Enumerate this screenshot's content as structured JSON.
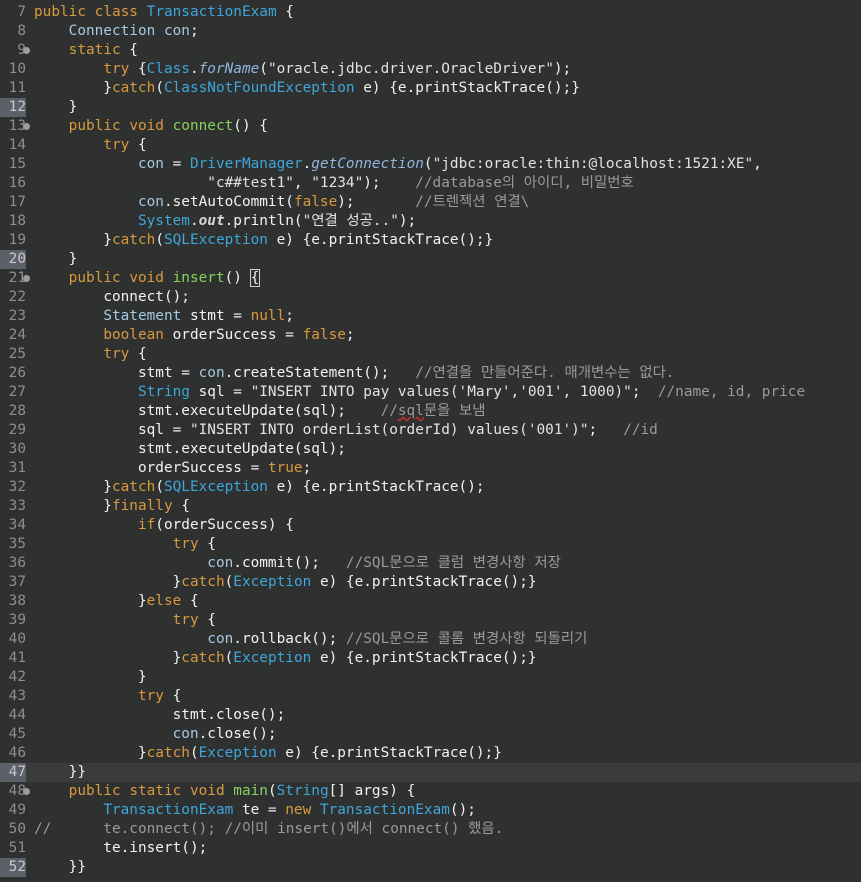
{
  "editor": {
    "language": "java",
    "current_line": 47,
    "colors": {
      "background": "#2f3030",
      "keyword": "#d99a3e",
      "class": "#3ea6d9",
      "method": "#89d05e",
      "comment": "#9a9a9a"
    },
    "lines": [
      {
        "no": "7",
        "fold": false,
        "hl": false,
        "tokens": [
          [
            "kw",
            "public"
          ],
          [
            "plain",
            " "
          ],
          [
            "kw",
            "class"
          ],
          [
            "plain",
            " "
          ],
          [
            "cls",
            "TransactionExam"
          ],
          [
            "plain",
            " {"
          ]
        ]
      },
      {
        "no": "8",
        "fold": false,
        "hl": false,
        "tokens": [
          [
            "plain",
            "    "
          ],
          [
            "type",
            "Connection"
          ],
          [
            "plain",
            " "
          ],
          [
            "field",
            "con"
          ],
          [
            "plain",
            ";"
          ]
        ]
      },
      {
        "no": "9",
        "fold": true,
        "hl": false,
        "tokens": [
          [
            "plain",
            "    "
          ],
          [
            "kw",
            "static"
          ],
          [
            "plain",
            " {"
          ]
        ]
      },
      {
        "no": "10",
        "fold": false,
        "hl": false,
        "tokens": [
          [
            "plain",
            "        "
          ],
          [
            "kw",
            "try"
          ],
          [
            "plain",
            " {"
          ],
          [
            "cls",
            "Class"
          ],
          [
            "plain",
            "."
          ],
          [
            "smeth",
            "forName"
          ],
          [
            "plain",
            "("
          ],
          [
            "str",
            "\"oracle.jdbc.driver.OracleDriver\""
          ],
          [
            "plain",
            ");"
          ]
        ]
      },
      {
        "no": "11",
        "fold": false,
        "hl": false,
        "tokens": [
          [
            "plain",
            "        }"
          ],
          [
            "kw",
            "catch"
          ],
          [
            "plain",
            "("
          ],
          [
            "cls",
            "ClassNotFoundException"
          ],
          [
            "plain",
            " e) {e.printStackTrace();}"
          ]
        ]
      },
      {
        "no": "12",
        "fold": false,
        "hl": true,
        "tokens": [
          [
            "plain",
            "    }"
          ]
        ]
      },
      {
        "no": "13",
        "fold": true,
        "hl": false,
        "tokens": [
          [
            "plain",
            "    "
          ],
          [
            "kw",
            "public"
          ],
          [
            "plain",
            " "
          ],
          [
            "kw",
            "void"
          ],
          [
            "plain",
            " "
          ],
          [
            "method",
            "connect"
          ],
          [
            "plain",
            "() {"
          ]
        ]
      },
      {
        "no": "14",
        "fold": false,
        "hl": false,
        "tokens": [
          [
            "plain",
            "        "
          ],
          [
            "kw",
            "try"
          ],
          [
            "plain",
            " {"
          ]
        ]
      },
      {
        "no": "15",
        "fold": false,
        "hl": false,
        "tokens": [
          [
            "plain",
            "            "
          ],
          [
            "field",
            "con"
          ],
          [
            "plain",
            " = "
          ],
          [
            "cls",
            "DriverManager"
          ],
          [
            "plain",
            "."
          ],
          [
            "smeth",
            "getConnection"
          ],
          [
            "plain",
            "("
          ],
          [
            "str",
            "\"jdbc:oracle:thin:@localhost:1521:XE\""
          ],
          [
            "plain",
            ","
          ]
        ]
      },
      {
        "no": "16",
        "fold": false,
        "hl": false,
        "tokens": [
          [
            "plain",
            "                    "
          ],
          [
            "str",
            "\"c##test1\""
          ],
          [
            "plain",
            ", "
          ],
          [
            "str",
            "\"1234\""
          ],
          [
            "plain",
            ");    "
          ],
          [
            "comment",
            "//database의 아이디, 비밀번호"
          ]
        ]
      },
      {
        "no": "17",
        "fold": false,
        "hl": false,
        "tokens": [
          [
            "plain",
            "            "
          ],
          [
            "field",
            "con"
          ],
          [
            "plain",
            ".setAutoCommit("
          ],
          [
            "kw",
            "false"
          ],
          [
            "plain",
            ");       "
          ],
          [
            "comment",
            "//트렌젝션 연결\\"
          ]
        ]
      },
      {
        "no": "18",
        "fold": false,
        "hl": false,
        "tokens": [
          [
            "plain",
            "            "
          ],
          [
            "cls",
            "System"
          ],
          [
            "plain",
            "."
          ],
          [
            "sfield",
            "out"
          ],
          [
            "plain",
            ".println("
          ],
          [
            "str",
            "\"연결 성공..\""
          ],
          [
            "plain",
            ");"
          ]
        ]
      },
      {
        "no": "19",
        "fold": false,
        "hl": false,
        "tokens": [
          [
            "plain",
            "        }"
          ],
          [
            "kw",
            "catch"
          ],
          [
            "plain",
            "("
          ],
          [
            "cls",
            "SQLException"
          ],
          [
            "plain",
            " e) {e.printStackTrace();}"
          ]
        ]
      },
      {
        "no": "20",
        "fold": false,
        "hl": true,
        "tokens": [
          [
            "plain",
            "    }"
          ]
        ]
      },
      {
        "no": "21",
        "fold": true,
        "hl": false,
        "tokens": [
          [
            "plain",
            "    "
          ],
          [
            "kw",
            "public"
          ],
          [
            "plain",
            " "
          ],
          [
            "kw",
            "void"
          ],
          [
            "plain",
            " "
          ],
          [
            "method",
            "insert"
          ],
          [
            "plain",
            "() "
          ],
          [
            "caret",
            "{"
          ]
        ]
      },
      {
        "no": "22",
        "fold": false,
        "hl": false,
        "tokens": [
          [
            "plain",
            "        "
          ],
          [
            "var",
            "connect"
          ],
          [
            "plain",
            "();"
          ]
        ]
      },
      {
        "no": "23",
        "fold": false,
        "hl": false,
        "tokens": [
          [
            "plain",
            "        "
          ],
          [
            "type",
            "Statement"
          ],
          [
            "plain",
            " stmt = "
          ],
          [
            "kw",
            "null"
          ],
          [
            "plain",
            ";"
          ]
        ]
      },
      {
        "no": "24",
        "fold": false,
        "hl": false,
        "tokens": [
          [
            "plain",
            "        "
          ],
          [
            "kw",
            "boolean"
          ],
          [
            "plain",
            " orderSuccess = "
          ],
          [
            "kw",
            "false"
          ],
          [
            "plain",
            ";"
          ]
        ]
      },
      {
        "no": "25",
        "fold": false,
        "hl": false,
        "tokens": [
          [
            "plain",
            "        "
          ],
          [
            "kw",
            "try"
          ],
          [
            "plain",
            " {"
          ]
        ]
      },
      {
        "no": "26",
        "fold": false,
        "hl": false,
        "tokens": [
          [
            "plain",
            "            stmt = "
          ],
          [
            "field",
            "con"
          ],
          [
            "plain",
            ".createStatement();   "
          ],
          [
            "comment",
            "//연결을 만들어준다. 매개변수는 없다."
          ]
        ]
      },
      {
        "no": "27",
        "fold": false,
        "hl": false,
        "tokens": [
          [
            "plain",
            "            "
          ],
          [
            "cls",
            "String"
          ],
          [
            "plain",
            " sql = "
          ],
          [
            "str",
            "\"INSERT INTO pay values('Mary','001', 1000)\""
          ],
          [
            "plain",
            ";  "
          ],
          [
            "comment",
            "//name, id, price"
          ]
        ]
      },
      {
        "no": "28",
        "fold": false,
        "hl": false,
        "tokens": [
          [
            "plain",
            "            stmt.executeUpdate(sql);    "
          ],
          [
            "comment",
            "//"
          ],
          [
            "squig",
            "sql"
          ],
          [
            "comment",
            "문을 보냄"
          ]
        ]
      },
      {
        "no": "29",
        "fold": false,
        "hl": false,
        "tokens": [
          [
            "plain",
            "            sql = "
          ],
          [
            "str",
            "\"INSERT INTO orderList(orderId) values('001')\""
          ],
          [
            "plain",
            ";   "
          ],
          [
            "comment",
            "//id"
          ]
        ]
      },
      {
        "no": "30",
        "fold": false,
        "hl": false,
        "tokens": [
          [
            "plain",
            "            stmt.executeUpdate(sql);"
          ]
        ]
      },
      {
        "no": "31",
        "fold": false,
        "hl": false,
        "tokens": [
          [
            "plain",
            "            orderSuccess = "
          ],
          [
            "kw",
            "true"
          ],
          [
            "plain",
            ";"
          ]
        ]
      },
      {
        "no": "32",
        "fold": false,
        "hl": false,
        "tokens": [
          [
            "plain",
            "        }"
          ],
          [
            "kw",
            "catch"
          ],
          [
            "plain",
            "("
          ],
          [
            "cls",
            "SQLException"
          ],
          [
            "plain",
            " e) {e.printStackTrace();"
          ]
        ]
      },
      {
        "no": "33",
        "fold": false,
        "hl": false,
        "tokens": [
          [
            "plain",
            "        }"
          ],
          [
            "kw",
            "finally"
          ],
          [
            "plain",
            " {"
          ]
        ]
      },
      {
        "no": "34",
        "fold": false,
        "hl": false,
        "tokens": [
          [
            "plain",
            "            "
          ],
          [
            "kw",
            "if"
          ],
          [
            "plain",
            "(orderSuccess) {"
          ]
        ]
      },
      {
        "no": "35",
        "fold": false,
        "hl": false,
        "tokens": [
          [
            "plain",
            "                "
          ],
          [
            "kw",
            "try"
          ],
          [
            "plain",
            " {"
          ]
        ]
      },
      {
        "no": "36",
        "fold": false,
        "hl": false,
        "tokens": [
          [
            "plain",
            "                    "
          ],
          [
            "field",
            "con"
          ],
          [
            "plain",
            ".commit();   "
          ],
          [
            "comment",
            "//SQL문으로 클럼 변경사항 저장"
          ]
        ]
      },
      {
        "no": "37",
        "fold": false,
        "hl": false,
        "tokens": [
          [
            "plain",
            "                }"
          ],
          [
            "kw",
            "catch"
          ],
          [
            "plain",
            "("
          ],
          [
            "cls",
            "Exception"
          ],
          [
            "plain",
            " e) {e.printStackTrace();}"
          ]
        ]
      },
      {
        "no": "38",
        "fold": false,
        "hl": false,
        "tokens": [
          [
            "plain",
            "            }"
          ],
          [
            "kw",
            "else"
          ],
          [
            "plain",
            " {"
          ]
        ]
      },
      {
        "no": "39",
        "fold": false,
        "hl": false,
        "tokens": [
          [
            "plain",
            "                "
          ],
          [
            "kw",
            "try"
          ],
          [
            "plain",
            " {"
          ]
        ]
      },
      {
        "no": "40",
        "fold": false,
        "hl": false,
        "tokens": [
          [
            "plain",
            "                    "
          ],
          [
            "field",
            "con"
          ],
          [
            "plain",
            ".rollback(); "
          ],
          [
            "comment",
            "//SQL문으로 콜롬 변경사항 되돌리기"
          ]
        ]
      },
      {
        "no": "41",
        "fold": false,
        "hl": false,
        "tokens": [
          [
            "plain",
            "                }"
          ],
          [
            "kw",
            "catch"
          ],
          [
            "plain",
            "("
          ],
          [
            "cls",
            "Exception"
          ],
          [
            "plain",
            " e) {e.printStackTrace();}"
          ]
        ]
      },
      {
        "no": "42",
        "fold": false,
        "hl": false,
        "tokens": [
          [
            "plain",
            "            }"
          ]
        ]
      },
      {
        "no": "43",
        "fold": false,
        "hl": false,
        "tokens": [
          [
            "plain",
            "            "
          ],
          [
            "kw",
            "try"
          ],
          [
            "plain",
            " {"
          ]
        ]
      },
      {
        "no": "44",
        "fold": false,
        "hl": false,
        "tokens": [
          [
            "plain",
            "                stmt.close();"
          ]
        ]
      },
      {
        "no": "45",
        "fold": false,
        "hl": false,
        "tokens": [
          [
            "plain",
            "                "
          ],
          [
            "field",
            "con"
          ],
          [
            "plain",
            ".close();"
          ]
        ]
      },
      {
        "no": "46",
        "fold": false,
        "hl": false,
        "tokens": [
          [
            "plain",
            "            }"
          ],
          [
            "kw",
            "catch"
          ],
          [
            "plain",
            "("
          ],
          [
            "cls",
            "Exception"
          ],
          [
            "plain",
            " e) {e.printStackTrace();}"
          ]
        ]
      },
      {
        "no": "47",
        "fold": false,
        "hl": true,
        "tokens": [
          [
            "plain",
            "    }}"
          ]
        ]
      },
      {
        "no": "48",
        "fold": true,
        "hl": false,
        "tokens": [
          [
            "plain",
            "    "
          ],
          [
            "kw",
            "public"
          ],
          [
            "plain",
            " "
          ],
          [
            "kw",
            "static"
          ],
          [
            "plain",
            " "
          ],
          [
            "kw",
            "void"
          ],
          [
            "plain",
            " "
          ],
          [
            "method",
            "main"
          ],
          [
            "plain",
            "("
          ],
          [
            "cls",
            "String"
          ],
          [
            "plain",
            "[] args) {"
          ]
        ]
      },
      {
        "no": "49",
        "fold": false,
        "hl": false,
        "tokens": [
          [
            "plain",
            "        "
          ],
          [
            "cls",
            "TransactionExam"
          ],
          [
            "plain",
            " te = "
          ],
          [
            "kw",
            "new"
          ],
          [
            "plain",
            " "
          ],
          [
            "cls",
            "TransactionExam"
          ],
          [
            "plain",
            "();"
          ]
        ]
      },
      {
        "no": "50",
        "fold": false,
        "hl": false,
        "tokens": [
          [
            "comment",
            "//      te.connect(); //이미 insert()에서 connect() 했음."
          ]
        ]
      },
      {
        "no": "51",
        "fold": false,
        "hl": false,
        "tokens": [
          [
            "plain",
            "        te.insert();"
          ]
        ]
      },
      {
        "no": "52",
        "fold": false,
        "hl": true,
        "tokens": [
          [
            "plain",
            "    }}"
          ]
        ]
      }
    ]
  }
}
